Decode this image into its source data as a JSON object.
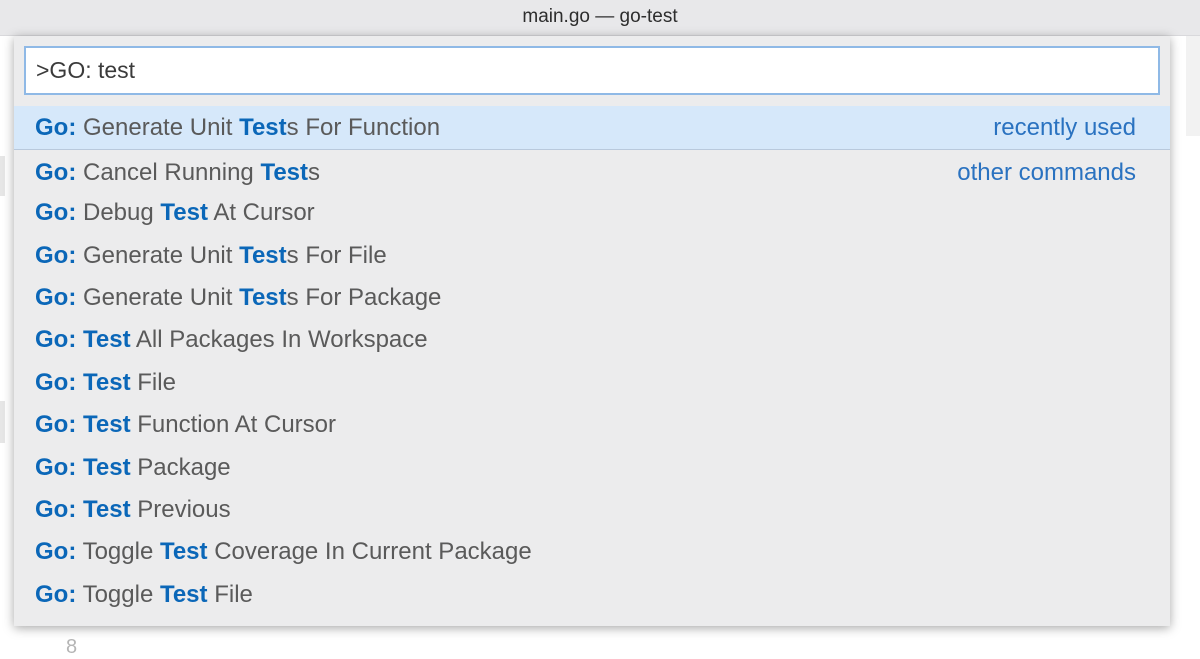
{
  "window": {
    "title": "main.go — go-test"
  },
  "editor": {
    "visible_line_number": "8"
  },
  "palette": {
    "input_value": ">GO: test",
    "accent_color": "#0b67b8",
    "selected_bg": "#d6e8fa",
    "items": [
      {
        "prefix": "Go:",
        "before": " Generate Unit ",
        "match": "Test",
        "after": "s For Function",
        "group": "recently used",
        "selected": true
      },
      {
        "prefix": "Go:",
        "before": " Cancel Running ",
        "match": "Test",
        "after": "s",
        "group": "other commands",
        "selected": false
      },
      {
        "prefix": "Go:",
        "before": " Debug ",
        "match": "Test",
        "after": " At Cursor",
        "group": "",
        "selected": false
      },
      {
        "prefix": "Go:",
        "before": " Generate Unit ",
        "match": "Test",
        "after": "s For File",
        "group": "",
        "selected": false
      },
      {
        "prefix": "Go:",
        "before": " Generate Unit ",
        "match": "Test",
        "after": "s For Package",
        "group": "",
        "selected": false
      },
      {
        "prefix": "Go:",
        "before": " ",
        "match": "Test",
        "after": " All Packages In Workspace",
        "group": "",
        "selected": false
      },
      {
        "prefix": "Go:",
        "before": " ",
        "match": "Test",
        "after": " File",
        "group": "",
        "selected": false
      },
      {
        "prefix": "Go:",
        "before": " ",
        "match": "Test",
        "after": " Function At Cursor",
        "group": "",
        "selected": false
      },
      {
        "prefix": "Go:",
        "before": " ",
        "match": "Test",
        "after": " Package",
        "group": "",
        "selected": false
      },
      {
        "prefix": "Go:",
        "before": " ",
        "match": "Test",
        "after": " Previous",
        "group": "",
        "selected": false
      },
      {
        "prefix": "Go:",
        "before": " Toggle ",
        "match": "Test",
        "after": " Coverage In Current Package",
        "group": "",
        "selected": false
      },
      {
        "prefix": "Go:",
        "before": " Toggle ",
        "match": "Test",
        "after": " File",
        "group": "",
        "selected": false
      }
    ]
  }
}
